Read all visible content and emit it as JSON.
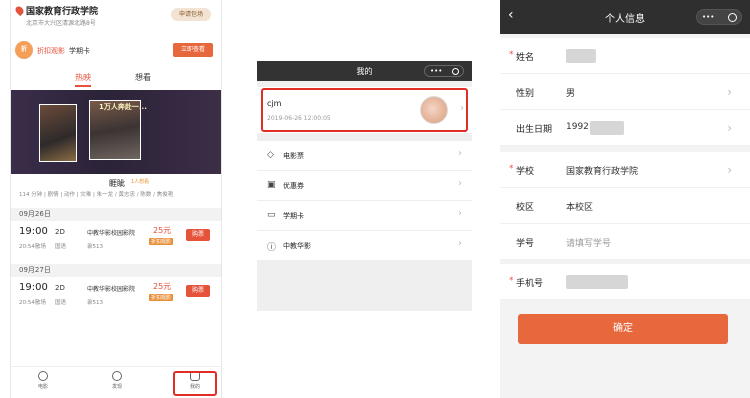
{
  "panel1": {
    "school": "国家教育行政学院",
    "address": "北京市大兴区清源北路8号",
    "apply_label": "申请包场",
    "promo_badge": "折",
    "promo_tag": "折扣观影",
    "promo_card": "学期卡",
    "promo_button": "立即查看",
    "tabs": [
      "热映",
      "想看"
    ],
    "poster_text": "1万人奔赴一...",
    "movie_title": "睚眦",
    "movie_sub": "1人想看",
    "movie_meta": "114 分钟 | 剧情 | 动作 | 灾难 | 朱一龙 / 黄志忠 / 陈数 / 焦俊艳",
    "dates": [
      "09月26日",
      "09月27日"
    ],
    "shows": [
      {
        "time": "19:00",
        "end": "20:54散场",
        "format": "2D",
        "lang": "国语",
        "cinema": "中教华影校园影院",
        "hall": "录513",
        "price": "25元",
        "discount": "折扣观影",
        "buy": "购票"
      },
      {
        "time": "19:00",
        "end": "20:54散场",
        "format": "2D",
        "lang": "国语",
        "cinema": "中教华影校园影院",
        "hall": "录513",
        "price": "25元",
        "discount": "折扣观影",
        "buy": "购票"
      }
    ],
    "nav": [
      "电影",
      "发现",
      "我的"
    ]
  },
  "panel2": {
    "title": "我的",
    "capsule_dots": "•••",
    "user_name": "cjm",
    "user_time": "2019-06-26 12:00:05",
    "chevron": "›",
    "menu": [
      {
        "icon": "◇",
        "label": "电影票"
      },
      {
        "icon": "▣",
        "label": "优惠券"
      },
      {
        "icon": "▭",
        "label": "学期卡"
      },
      {
        "icon": "ⓘ",
        "label": "中教华影"
      }
    ]
  },
  "panel3": {
    "back": "‹",
    "title": "个人信息",
    "capsule_dots": "•••",
    "chevron": "›",
    "required_mark": "*",
    "name_label": "姓名",
    "gender_label": "性别",
    "gender_value": "男",
    "birthday_label": "出生日期",
    "birthday_value": "1992",
    "school_label": "学校",
    "school_value": "国家教育行政学院",
    "campus_label": "校区",
    "campus_value": "本校区",
    "student_id_label": "学号",
    "student_id_placeholder": "请填写学号",
    "phone_label": "手机号",
    "confirm_label": "确定"
  }
}
